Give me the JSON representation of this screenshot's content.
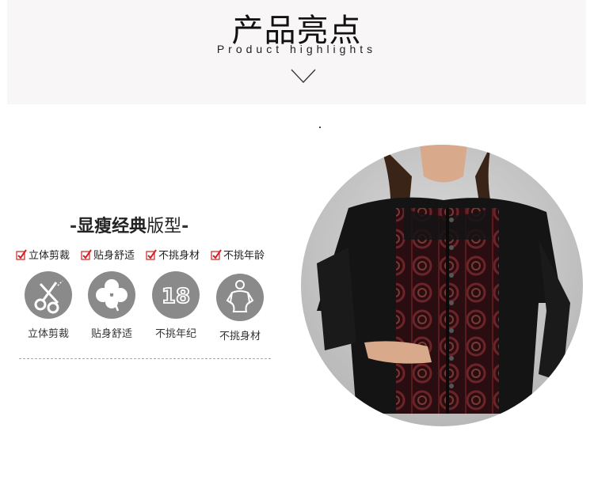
{
  "header": {
    "title": "产品亮点",
    "subtitle": "Product highlights"
  },
  "section": {
    "title_bold": "显瘦经典",
    "title_regular": "版型",
    "dash": "-"
  },
  "tags": [
    {
      "label": "立体剪裁"
    },
    {
      "label": "贴身舒适"
    },
    {
      "label": "不挑身材"
    },
    {
      "label": "不挑年龄"
    }
  ],
  "features": [
    {
      "label": "立体剪裁",
      "icon": "scissors-icon"
    },
    {
      "label": "贴身舒适",
      "icon": "clover-icon"
    },
    {
      "label": "不挑年纪",
      "icon": "age-18-icon",
      "icon_text": "18"
    },
    {
      "label": "不挑身材",
      "icon": "body-silhouette-icon"
    }
  ],
  "colors": {
    "header_bg": "#f8f6f6",
    "icon_circle": "#8a8a8a",
    "check_red": "#d32020",
    "blouse_black": "#141414",
    "blouse_pattern": "#5a1a1e"
  }
}
